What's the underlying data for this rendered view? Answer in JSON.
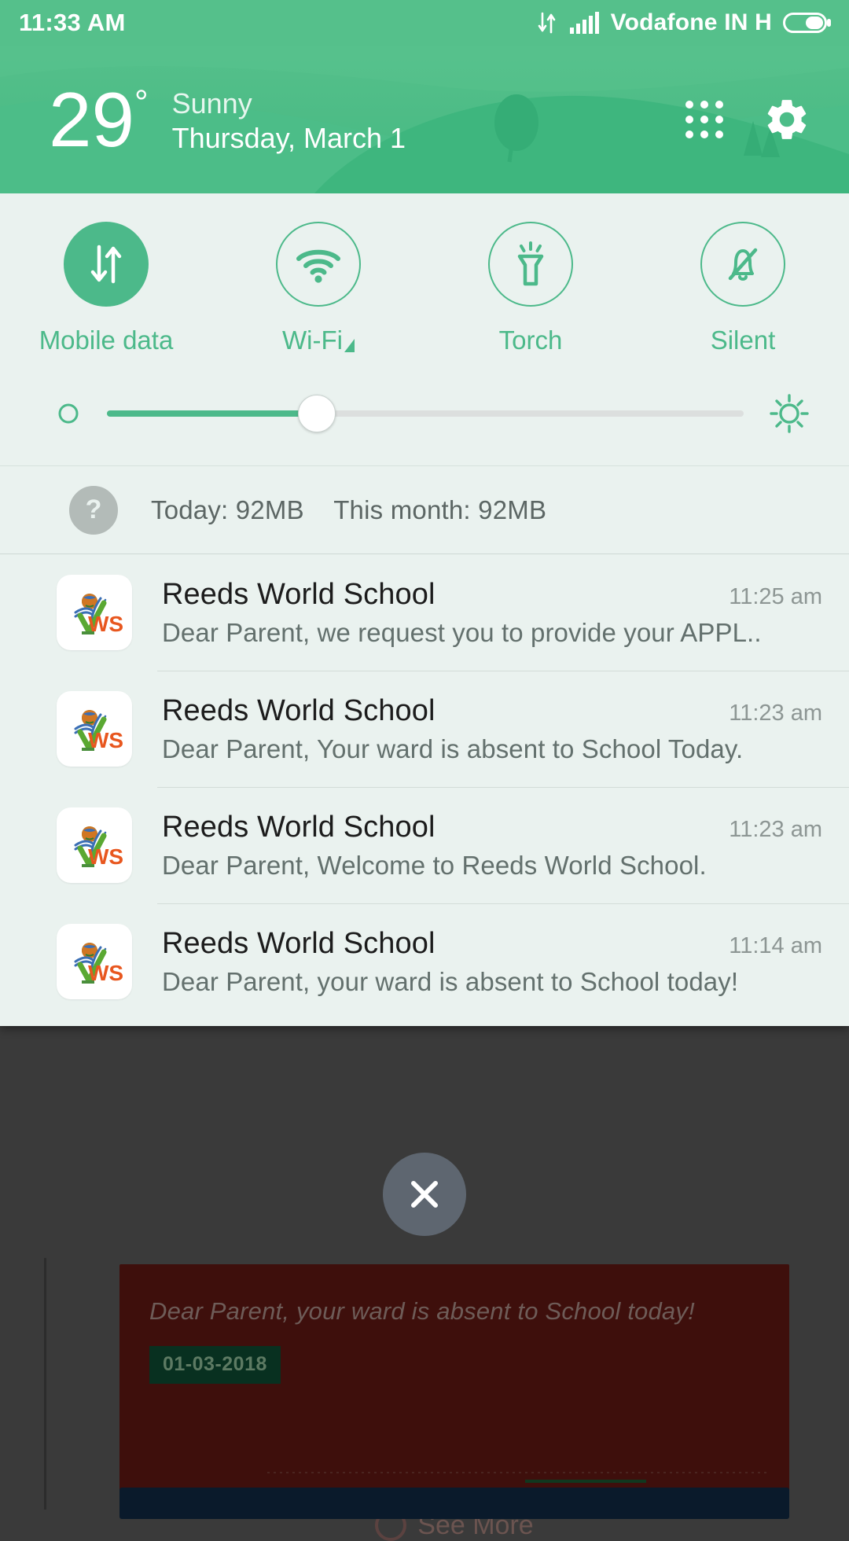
{
  "statusbar": {
    "time": "11:33 AM",
    "carrier": "Vodafone IN  H",
    "icons": [
      "data-transfer-icon",
      "signal-bars-icon",
      "battery-icon"
    ]
  },
  "weather": {
    "temperature": "29",
    "degree_symbol": "°",
    "condition": "Sunny",
    "date": "Thursday, March 1",
    "apps_grid_label": "app-grid-icon",
    "settings_label": "gear-icon",
    "bg_color": "#55c08b"
  },
  "quick_settings": {
    "accent_color": "#4cb98a",
    "panel_color": "#eaf2ef",
    "tiles": [
      {
        "label": "Mobile data",
        "icon": "data-transfer-icon",
        "active": true
      },
      {
        "label": "Wi-Fi",
        "icon": "wifi-icon",
        "active": false,
        "has_caret": true
      },
      {
        "label": "Torch",
        "icon": "flashlight-icon",
        "active": false
      },
      {
        "label": "Silent",
        "icon": "bell-muted-icon",
        "active": false
      }
    ]
  },
  "brightness": {
    "min_icon": "brightness-low-icon",
    "max_icon": "brightness-high-icon",
    "value_percent": 33
  },
  "data_usage": {
    "help_icon": "question-mark-icon",
    "today_label": "Today: 92MB",
    "month_label": "This month: 92MB"
  },
  "notifications": [
    {
      "app": "Reeds World School",
      "time": "11:25 am",
      "text": "Dear Parent, we request you to provide your APPL..",
      "icon": "reeds-world-school-logo"
    },
    {
      "app": "Reeds World School",
      "time": "11:23 am",
      "text": "Dear Parent, Your ward is absent to School Today.",
      "icon": "reeds-world-school-logo"
    },
    {
      "app": "Reeds World School",
      "time": "11:23 am",
      "text": "Dear Parent, Welcome to Reeds World School.",
      "icon": "reeds-world-school-logo"
    },
    {
      "app": "Reeds World School",
      "time": "11:14 am",
      "text": "Dear Parent, your ward is absent to School today!",
      "icon": "reeds-world-school-logo"
    }
  ],
  "background_app": {
    "message": "Dear Parent, your ward is absent to School today!",
    "date_badge": "01-03-2018",
    "see_more_label": "See More"
  },
  "close_button": {
    "icon": "close-x-icon",
    "color": "#5e6670"
  }
}
